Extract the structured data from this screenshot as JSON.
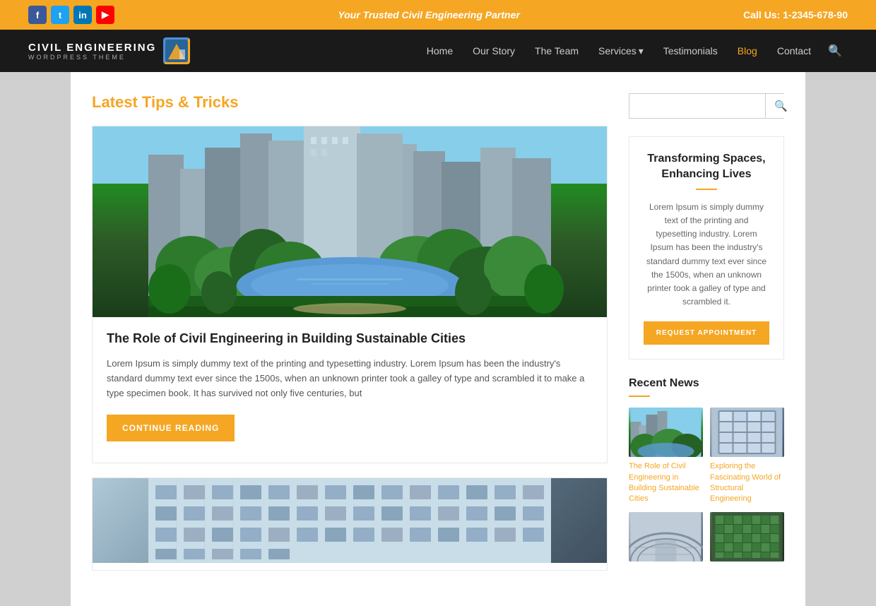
{
  "topbar": {
    "tagline": "Your Trusted Civil Engineering Partner",
    "phone": "Call Us: 1-2345-678-90",
    "social": [
      {
        "name": "Facebook",
        "key": "fb",
        "letter": "f"
      },
      {
        "name": "Twitter",
        "key": "tw",
        "letter": "t"
      },
      {
        "name": "LinkedIn",
        "key": "li",
        "letter": "in"
      },
      {
        "name": "YouTube",
        "key": "yt",
        "letter": "▶"
      }
    ]
  },
  "nav": {
    "logo_title": "CIVIL ENGINEERING",
    "logo_subtitle": "WORDPRESS THEME",
    "links": [
      {
        "label": "Home",
        "active": false
      },
      {
        "label": "Our Story",
        "active": false
      },
      {
        "label": "The Team",
        "active": false
      },
      {
        "label": "Services",
        "active": false,
        "has_dropdown": true
      },
      {
        "label": "Testimonials",
        "active": false
      },
      {
        "label": "Blog",
        "active": true
      },
      {
        "label": "Contact",
        "active": false
      }
    ]
  },
  "main": {
    "section_title": "Latest Tips & Tricks",
    "post": {
      "title": "The Role of Civil Engineering in Building Sustainable Cities",
      "excerpt": "Lorem Ipsum is simply dummy text of the printing and typesetting industry. Lorem Ipsum has been the industry's standard dummy text ever since the 1500s, when an unknown printer took a galley of type and scrambled it to make a type specimen book. It has survived not only five centuries, but",
      "continue_label": "CONTINUE READING"
    }
  },
  "sidebar": {
    "search_placeholder": "",
    "card": {
      "title": "Transforming Spaces, Enhancing Lives",
      "text": "Lorem Ipsum is simply dummy text of the printing and typesetting industry. Lorem Ipsum has been the industry's standard dummy text ever since the 1500s, when an unknown printer took a galley of type and scrambled it.",
      "button_label": "REQUEST APPOINTMENT"
    },
    "recent_news": {
      "title": "Recent News",
      "items": [
        {
          "title": "The Role of Civil Engineering in Building Sustainable Cities"
        },
        {
          "title": "Exploring the Fascinating World of Structural Engineering"
        },
        {
          "title": ""
        },
        {
          "title": ""
        }
      ]
    }
  }
}
